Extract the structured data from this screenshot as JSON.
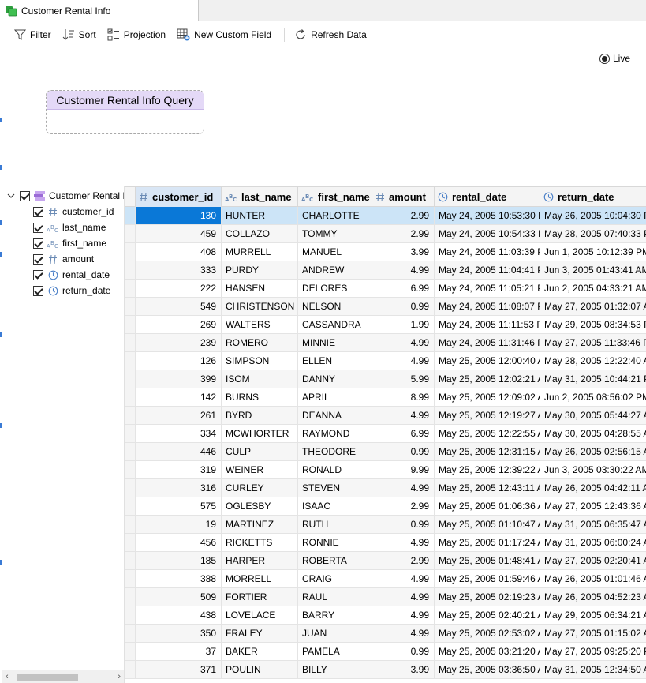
{
  "tab": {
    "title": "Customer Rental Info",
    "icon": "table-stack-icon"
  },
  "toolbar": {
    "filter_label": "Filter",
    "sort_label": "Sort",
    "projection_label": "Projection",
    "new_custom_field_label": "New Custom Field",
    "refresh_label": "Refresh Data"
  },
  "diagram": {
    "live_label": "Live",
    "query_title": "Customer Rental Info Query"
  },
  "tree": {
    "root_label": "Customer Rental I",
    "fields": [
      {
        "name": "customer_id",
        "icon": "number-icon"
      },
      {
        "name": "last_name",
        "icon": "text-abc-icon"
      },
      {
        "name": "first_name",
        "icon": "text-abc-icon"
      },
      {
        "name": "amount",
        "icon": "number-icon"
      },
      {
        "name": "rental_date",
        "icon": "clock-icon"
      },
      {
        "name": "return_date",
        "icon": "clock-icon"
      }
    ]
  },
  "grid": {
    "columns": [
      {
        "label": "customer_id",
        "icon": "number-icon"
      },
      {
        "label": "last_name",
        "icon": "text-abc-icon"
      },
      {
        "label": "first_name",
        "icon": "text-abc-icon"
      },
      {
        "label": "amount",
        "icon": "number-icon"
      },
      {
        "label": "rental_date",
        "icon": "clock-icon"
      },
      {
        "label": "return_date",
        "icon": "clock-icon"
      }
    ],
    "rows": [
      [
        "130",
        "HUNTER",
        "CHARLOTTE",
        "2.99",
        "May 24, 2005 10:53:30 P",
        "May 26, 2005 10:04:30 P"
      ],
      [
        "459",
        "COLLAZO",
        "TOMMY",
        "2.99",
        "May 24, 2005 10:54:33 P",
        "May 28, 2005 07:40:33 P"
      ],
      [
        "408",
        "MURRELL",
        "MANUEL",
        "3.99",
        "May 24, 2005 11:03:39 P",
        "Jun 1, 2005 10:12:39 PM"
      ],
      [
        "333",
        "PURDY",
        "ANDREW",
        "4.99",
        "May 24, 2005 11:04:41 P",
        "Jun 3, 2005 01:43:41 AM"
      ],
      [
        "222",
        "HANSEN",
        "DELORES",
        "6.99",
        "May 24, 2005 11:05:21 P",
        "Jun 2, 2005 04:33:21 AM"
      ],
      [
        "549",
        "CHRISTENSON",
        "NELSON",
        "0.99",
        "May 24, 2005 11:08:07 P",
        "May 27, 2005 01:32:07 A"
      ],
      [
        "269",
        "WALTERS",
        "CASSANDRA",
        "1.99",
        "May 24, 2005 11:11:53 P",
        "May 29, 2005 08:34:53 P"
      ],
      [
        "239",
        "ROMERO",
        "MINNIE",
        "4.99",
        "May 24, 2005 11:31:46 P",
        "May 27, 2005 11:33:46 P"
      ],
      [
        "126",
        "SIMPSON",
        "ELLEN",
        "4.99",
        "May 25, 2005 12:00:40 A",
        "May 28, 2005 12:22:40 A"
      ],
      [
        "399",
        "ISOM",
        "DANNY",
        "5.99",
        "May 25, 2005 12:02:21 A",
        "May 31, 2005 10:44:21 P"
      ],
      [
        "142",
        "BURNS",
        "APRIL",
        "8.99",
        "May 25, 2005 12:09:02 A",
        "Jun 2, 2005 08:56:02 PM"
      ],
      [
        "261",
        "BYRD",
        "DEANNA",
        "4.99",
        "May 25, 2005 12:19:27 A",
        "May 30, 2005 05:44:27 A"
      ],
      [
        "334",
        "MCWHORTER",
        "RAYMOND",
        "6.99",
        "May 25, 2005 12:22:55 A",
        "May 30, 2005 04:28:55 A"
      ],
      [
        "446",
        "CULP",
        "THEODORE",
        "0.99",
        "May 25, 2005 12:31:15 A",
        "May 26, 2005 02:56:15 A"
      ],
      [
        "319",
        "WEINER",
        "RONALD",
        "9.99",
        "May 25, 2005 12:39:22 A",
        "Jun 3, 2005 03:30:22 AM"
      ],
      [
        "316",
        "CURLEY",
        "STEVEN",
        "4.99",
        "May 25, 2005 12:43:11 A",
        "May 26, 2005 04:42:11 A"
      ],
      [
        "575",
        "OGLESBY",
        "ISAAC",
        "2.99",
        "May 25, 2005 01:06:36 A",
        "May 27, 2005 12:43:36 A"
      ],
      [
        "19",
        "MARTINEZ",
        "RUTH",
        "0.99",
        "May 25, 2005 01:10:47 A",
        "May 31, 2005 06:35:47 A"
      ],
      [
        "456",
        "RICKETTS",
        "RONNIE",
        "4.99",
        "May 25, 2005 01:17:24 A",
        "May 31, 2005 06:00:24 A"
      ],
      [
        "185",
        "HARPER",
        "ROBERTA",
        "2.99",
        "May 25, 2005 01:48:41 A",
        "May 27, 2005 02:20:41 A"
      ],
      [
        "388",
        "MORRELL",
        "CRAIG",
        "4.99",
        "May 25, 2005 01:59:46 A",
        "May 26, 2005 01:01:46 A"
      ],
      [
        "509",
        "FORTIER",
        "RAUL",
        "4.99",
        "May 25, 2005 02:19:23 A",
        "May 26, 2005 04:52:23 A"
      ],
      [
        "438",
        "LOVELACE",
        "BARRY",
        "4.99",
        "May 25, 2005 02:40:21 A",
        "May 29, 2005 06:34:21 A"
      ],
      [
        "350",
        "FRALEY",
        "JUAN",
        "4.99",
        "May 25, 2005 02:53:02 A",
        "May 27, 2005 01:15:02 A"
      ],
      [
        "37",
        "BAKER",
        "PAMELA",
        "0.99",
        "May 25, 2005 03:21:20 A",
        "May 27, 2005 09:25:20 P"
      ],
      [
        "371",
        "POULIN",
        "BILLY",
        "3.99",
        "May 25, 2005 03:36:50 A",
        "May 31, 2005 12:34:50 A"
      ]
    ],
    "selected_row": 0,
    "colors": {
      "selected_cell": "#0a78d7",
      "selected_row": "#cce4f7",
      "header_selected": "#d9e6f5"
    }
  }
}
